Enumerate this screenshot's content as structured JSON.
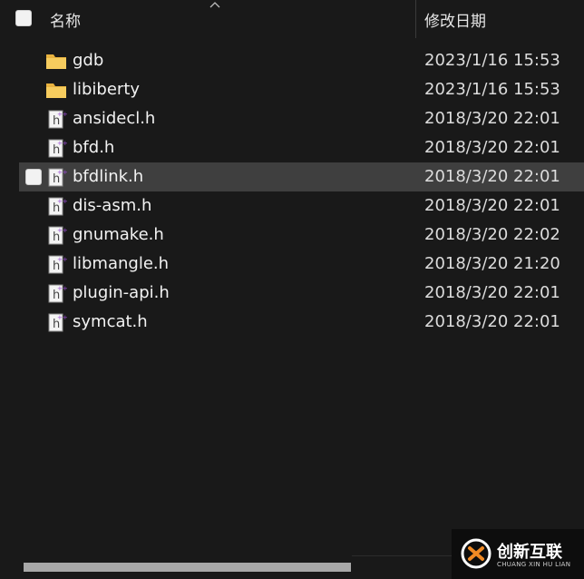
{
  "header": {
    "name_label": "名称",
    "date_label": "修改日期"
  },
  "files": [
    {
      "name": "gdb",
      "type": "folder",
      "date": "2023/1/16 15:53"
    },
    {
      "name": "libiberty",
      "type": "folder",
      "date": "2023/1/16 15:53"
    },
    {
      "name": "ansidecl.h",
      "type": "h-file",
      "date": "2018/3/20 22:01"
    },
    {
      "name": "bfd.h",
      "type": "h-file",
      "date": "2018/3/20 22:01"
    },
    {
      "name": "bfdlink.h",
      "type": "h-file",
      "date": "2018/3/20 22:01",
      "selected": true
    },
    {
      "name": "dis-asm.h",
      "type": "h-file",
      "date": "2018/3/20 22:01"
    },
    {
      "name": "gnumake.h",
      "type": "h-file",
      "date": "2018/3/20 22:02"
    },
    {
      "name": "libmangle.h",
      "type": "h-file",
      "date": "2018/3/20 21:20"
    },
    {
      "name": "plugin-api.h",
      "type": "h-file",
      "date": "2018/3/20 22:01"
    },
    {
      "name": "symcat.h",
      "type": "h-file",
      "date": "2018/3/20 22:01"
    }
  ],
  "watermark": {
    "cn": "创新互联",
    "en": "CHUANG XIN HU LIAN"
  },
  "colors": {
    "background": "#191919",
    "selected_row": "#3f3f3f",
    "folder": "#f4c65a",
    "text": "#f2f2f2"
  }
}
